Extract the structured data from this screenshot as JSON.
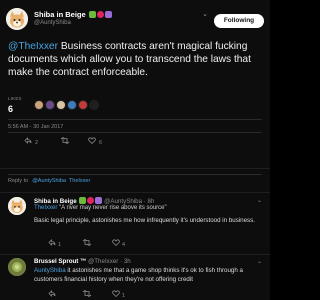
{
  "tweet": {
    "author_name": "Shiba in Beige",
    "author_handle": "@AuntyShiba",
    "follow_label": "Following",
    "mention": "@TheIxxer",
    "text": " Business contracts aren't magical fucking documents which allow you to transcend the laws that make the contract enforceable.",
    "likes_label": "LIKES",
    "likes_count": "6",
    "timestamp": "5:56 AM - 30 Jan 2017",
    "reply_count": "2",
    "like_count": "6"
  },
  "reply_box": {
    "prefix": "Reply to",
    "users": [
      "@AuntyShiba",
      "TheIxxer"
    ]
  },
  "replies": [
    {
      "name": "Shiba in Beige",
      "handle": "@AuntyShiba · 8h",
      "sub_prefix": "TheIxxer",
      "sub_text": " \"A river may never rise above its source\"",
      "text": "Basic legal principle, astonishes me how infrequently it's understood in business.",
      "replies": "1",
      "likes": "4"
    },
    {
      "name": "Brussel Sprout ™",
      "handle": "@TheIxxer · 3h",
      "sub_prefix": "AuntyShiba",
      "sub_text": " it astonishes me that a game shop thinks it's ok to fish through a customers financial history when they're not offering credit",
      "text": "",
      "replies": "",
      "likes": "1"
    }
  ],
  "colors": {
    "accent": "#4aa3df",
    "background": "#0d0d0d",
    "muted": "#8a8a8a",
    "like": "#e0245e"
  },
  "icons": {
    "reply": "reply-icon",
    "retweet": "retweet-icon",
    "like": "heart-icon",
    "more": "more-icon"
  }
}
